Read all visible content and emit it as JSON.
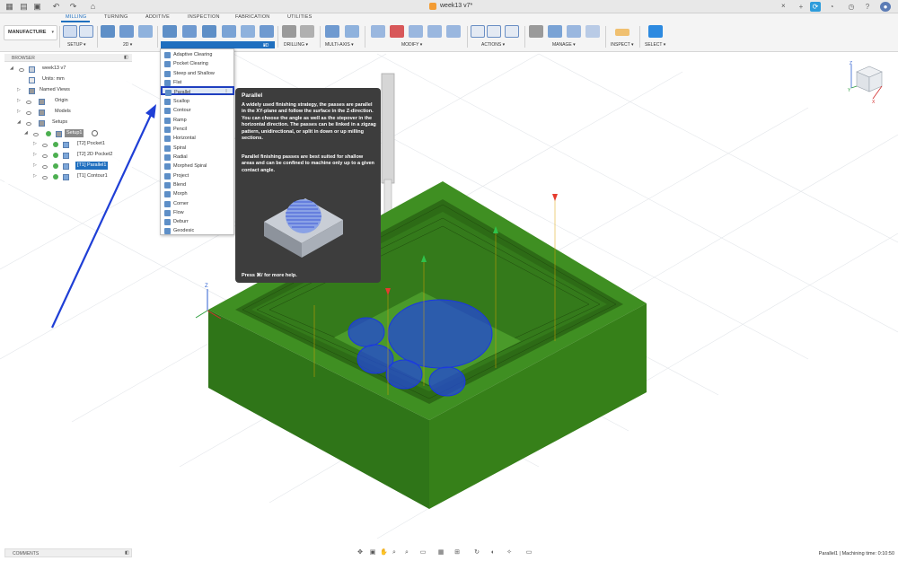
{
  "window": {
    "document_title": "week13 v7*"
  },
  "tabs": [
    {
      "label": "MILLING",
      "active": true
    },
    {
      "label": "TURNING"
    },
    {
      "label": "ADDITIVE"
    },
    {
      "label": "INSPECTION"
    },
    {
      "label": "FABRICATION"
    },
    {
      "label": "UTILITIES"
    }
  ],
  "ribbon": {
    "workspace": "MANUFACTURE",
    "groups": {
      "setup": "SETUP",
      "g2d": "2D",
      "g3d": "3D",
      "drilling": "DRILLING",
      "multiaxis": "MULTI-AXIS",
      "modify": "MODIFY",
      "actions": "ACTIONS",
      "manage": "MANAGE",
      "inspect": "INSPECT",
      "select": "SELECT"
    },
    "caret": "▾",
    "accent_color": "#1f6fbf"
  },
  "browser": {
    "header": "BROWSER",
    "pin": "◧",
    "rows": [
      {
        "label": "week13 v7"
      },
      {
        "label": "Units: mm"
      },
      {
        "label": "Named Views"
      },
      {
        "label": "Origin"
      },
      {
        "label": "Models"
      },
      {
        "label": "Setups"
      },
      {
        "label": "Setup1"
      },
      {
        "label": "[T2] Pocket1"
      },
      {
        "label": "[T2] 2D Pocket2"
      },
      {
        "label": "[T1] Parallel1",
        "selected": true
      },
      {
        "label": "[T1] Contour1"
      }
    ]
  },
  "menu_3d": {
    "items": [
      {
        "label": "Adaptive Clearing"
      },
      {
        "label": "Pocket Clearing"
      },
      {
        "label": "Steep and Shallow"
      },
      {
        "label": "Flat"
      },
      {
        "label": "Parallel",
        "highlighted": true
      },
      {
        "label": "Scallop"
      },
      {
        "label": "Contour"
      },
      {
        "label": "Ramp"
      },
      {
        "label": "Pencil"
      },
      {
        "label": "Horizontal"
      },
      {
        "label": "Spiral"
      },
      {
        "label": "Radial"
      },
      {
        "label": "Morphed Spiral"
      },
      {
        "label": "Project"
      },
      {
        "label": "Blend"
      },
      {
        "label": "Morph"
      },
      {
        "label": "Corner"
      },
      {
        "label": "Flow"
      },
      {
        "label": "Deburr"
      },
      {
        "label": "Geodesic"
      }
    ],
    "more_glyph": "⋮"
  },
  "tooltip": {
    "title": "Parallel",
    "paragraph1": "A widely used finishing strategy, the passes are parallel in the XY-plane and follow the surface in the Z-direction. You can choose the angle as well as the stepover in the horizontal direction. The passes can be linked in a zigzag pattern, unidirectional, or split in down or up milling sections.",
    "paragraph2": "Parallel finishing passes are best suited for shallow areas and can be confined to machine only up to a given contact angle.",
    "help": "Press ⌘/ for more help."
  },
  "viewcube": {
    "axis_x": "X",
    "axis_y": "Y",
    "axis_z": "Z"
  },
  "viewport": {
    "axis_z": "Z"
  },
  "comments": {
    "label": "COMMENTS",
    "pin": "◧"
  },
  "status": {
    "text": "Parallel1 | Machining time: 0:10:50"
  },
  "colors": {
    "stock_green": "#3f8f22",
    "toolpath_blue": "#1a37e0",
    "tooltip_bg": "#3d3d3d"
  }
}
